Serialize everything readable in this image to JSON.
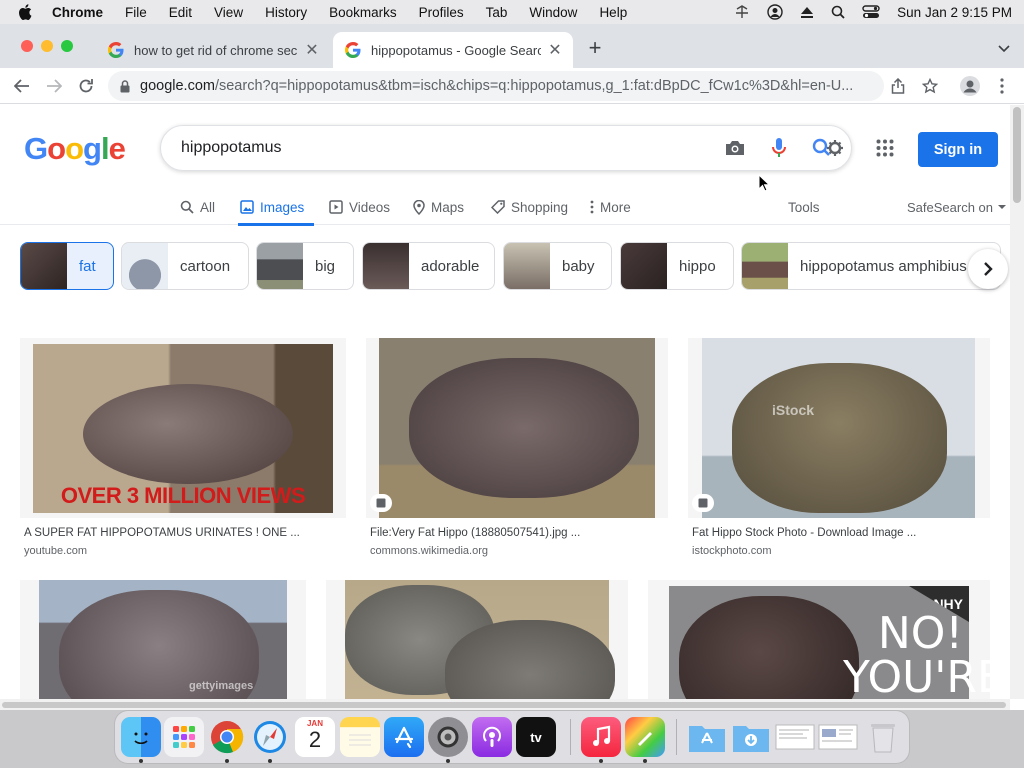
{
  "menubar": {
    "app": "Chrome",
    "items": [
      "File",
      "Edit",
      "View",
      "History",
      "Bookmarks",
      "Profiles",
      "Tab",
      "Window",
      "Help"
    ],
    "clock": "Sun Jan 2  9:15 PM"
  },
  "tabs": [
    {
      "title": "how to get rid of chrome secur",
      "active": false
    },
    {
      "title": "hippopotamus - Google Search",
      "active": true
    }
  ],
  "toolbar": {
    "url_host": "google.com",
    "url_rest": "/search?q=hippopotamus&tbm=isch&chips=q:hippopotamus,g_1:fat:dBpDC_fCw1c%3D&hl=en-U..."
  },
  "google": {
    "logo": "Google",
    "query": "hippopotamus",
    "signin_label": "Sign in",
    "nav": [
      {
        "label": "All",
        "icon": "search-icon"
      },
      {
        "label": "Images",
        "icon": "image-icon",
        "active": true
      },
      {
        "label": "Videos",
        "icon": "video-icon"
      },
      {
        "label": "Maps",
        "icon": "map-pin-icon"
      },
      {
        "label": "Shopping",
        "icon": "tag-icon"
      },
      {
        "label": "More",
        "icon": "more-dots-icon"
      }
    ],
    "tools_label": "Tools",
    "safesearch_label": "SafeSearch on",
    "chips": [
      "fat",
      "cartoon",
      "big",
      "adorable",
      "baby",
      "hippo",
      "hippopotamus amphibius"
    ],
    "results": [
      {
        "title": "A SUPER FAT HIPPOPOTAMUS URINATES ! ONE ...",
        "source": "youtube.com",
        "overlay": "OVER 3 MILLION VIEWS"
      },
      {
        "title": "File:Very Fat Hippo (18880507541).jpg ...",
        "source": "commons.wikimedia.org"
      },
      {
        "title": "Fat Hippo Stock Photo - Download Image ...",
        "source": "istockphoto.com",
        "watermark": "iStock"
      },
      {
        "title": "",
        "source": "",
        "watermark": "gettyimages"
      },
      {
        "title": "",
        "source": ""
      },
      {
        "title": "",
        "source": "",
        "corner": "NHY",
        "bigtext": "NO! YOU'RE FAT!"
      }
    ]
  },
  "dock": {
    "calendar_month": "JAN",
    "calendar_day": "2"
  },
  "colors": {
    "accent": "#1a73e8",
    "tabstrip": "#dee1e6"
  }
}
